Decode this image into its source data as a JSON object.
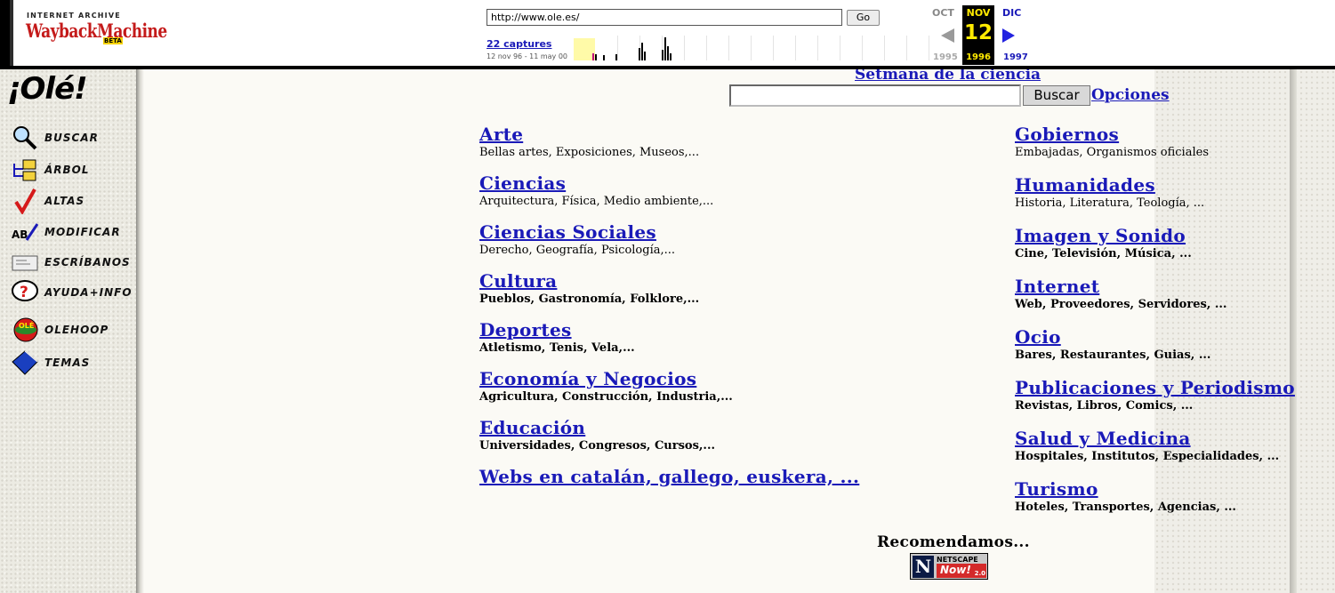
{
  "wayback": {
    "logo_top": "INTERNET ARCHIVE",
    "logo_main": "WaybackMachine",
    "logo_badge": "BETA",
    "url": "http://www.ole.es/",
    "go_label": "Go",
    "captures_label": "22 captures",
    "range_label": "12 nov 96 - 11 may 00",
    "prev_month": "OCT",
    "current_month": "NOV",
    "next_month": "DIC",
    "current_day": "12",
    "prev_year": "1995",
    "current_year": "1996",
    "next_year": "1997"
  },
  "sidebar": {
    "logo": "¡Olé!",
    "items": [
      {
        "label": "BUSCAR",
        "icon": "magnifier-icon"
      },
      {
        "label": "ÁRBOL",
        "icon": "folder-tree-icon"
      },
      {
        "label": "ALTAS",
        "icon": "checkmark-icon"
      },
      {
        "label": "MODIFICAR",
        "icon": "pencil-edit-icon"
      },
      {
        "label": "ESCRÍBANOS",
        "icon": "envelope-icon"
      },
      {
        "label": "AYUDA+INFO",
        "icon": "question-bubble-icon"
      },
      {
        "label": "OLEHOOP",
        "icon": "olehoop-logo-icon"
      },
      {
        "label": "TEMAS",
        "icon": "book-icon"
      }
    ]
  },
  "header": {
    "setmana_link": "Setmana de la ciencia",
    "search_value": "",
    "buscar_label": "Buscar",
    "opciones_label": "Opciones"
  },
  "categories_left": [
    {
      "title": "Arte",
      "sub": "Bellas artes, Exposiciones, Museos,..."
    },
    {
      "title": "Ciencias",
      "sub": "Arquitectura, Física, Medio ambiente,..."
    },
    {
      "title": "Ciencias Sociales",
      "sub": "Derecho, Geografía, Psicología,..."
    },
    {
      "title": "Cultura",
      "sub": "Pueblos, Gastronomía, Folklore,..."
    },
    {
      "title": "Deportes",
      "sub": "Atletismo, Tenis, Vela,..."
    },
    {
      "title": "Economía y Negocios",
      "sub": "Agricultura, Construcción, Industria,..."
    },
    {
      "title": "Educación",
      "sub": "Universidades, Congresos, Cursos,..."
    },
    {
      "title": "Webs en catalán, gallego, euskera, ...",
      "sub": ""
    }
  ],
  "categories_right": [
    {
      "title": "Gobiernos",
      "sub": "Embajadas, Organismos oficiales"
    },
    {
      "title": "Humanidades",
      "sub": "Historia, Literatura, Teología, ..."
    },
    {
      "title": "Imagen y Sonido",
      "sub": "Cine, Televisión, Música, ..."
    },
    {
      "title": "Internet",
      "sub": "Web, Proveedores, Servidores, ..."
    },
    {
      "title": "Ocio",
      "sub": "Bares, Restaurantes, Guias, ..."
    },
    {
      "title": "Publicaciones y Periodismo",
      "sub": "Revistas, Libros, Comics, ..."
    },
    {
      "title": "Salud y Medicina",
      "sub": "Hospitales, Institutos, Especialidades, ..."
    },
    {
      "title": "Turismo",
      "sub": "Hoteles, Transportes, Agencias, ..."
    }
  ],
  "footer": {
    "recomendamos": "Recomendamos...",
    "netscape_letter": "N",
    "netscape_top": "NETSCAPE",
    "netscape_now": "Now!",
    "netscape_version": "2.0"
  },
  "colors": {
    "link": "#1a1ab8",
    "wayback_red": "#c41a1a",
    "calendar_yellow": "#ffea00",
    "next_arrow": "#2323e0"
  }
}
